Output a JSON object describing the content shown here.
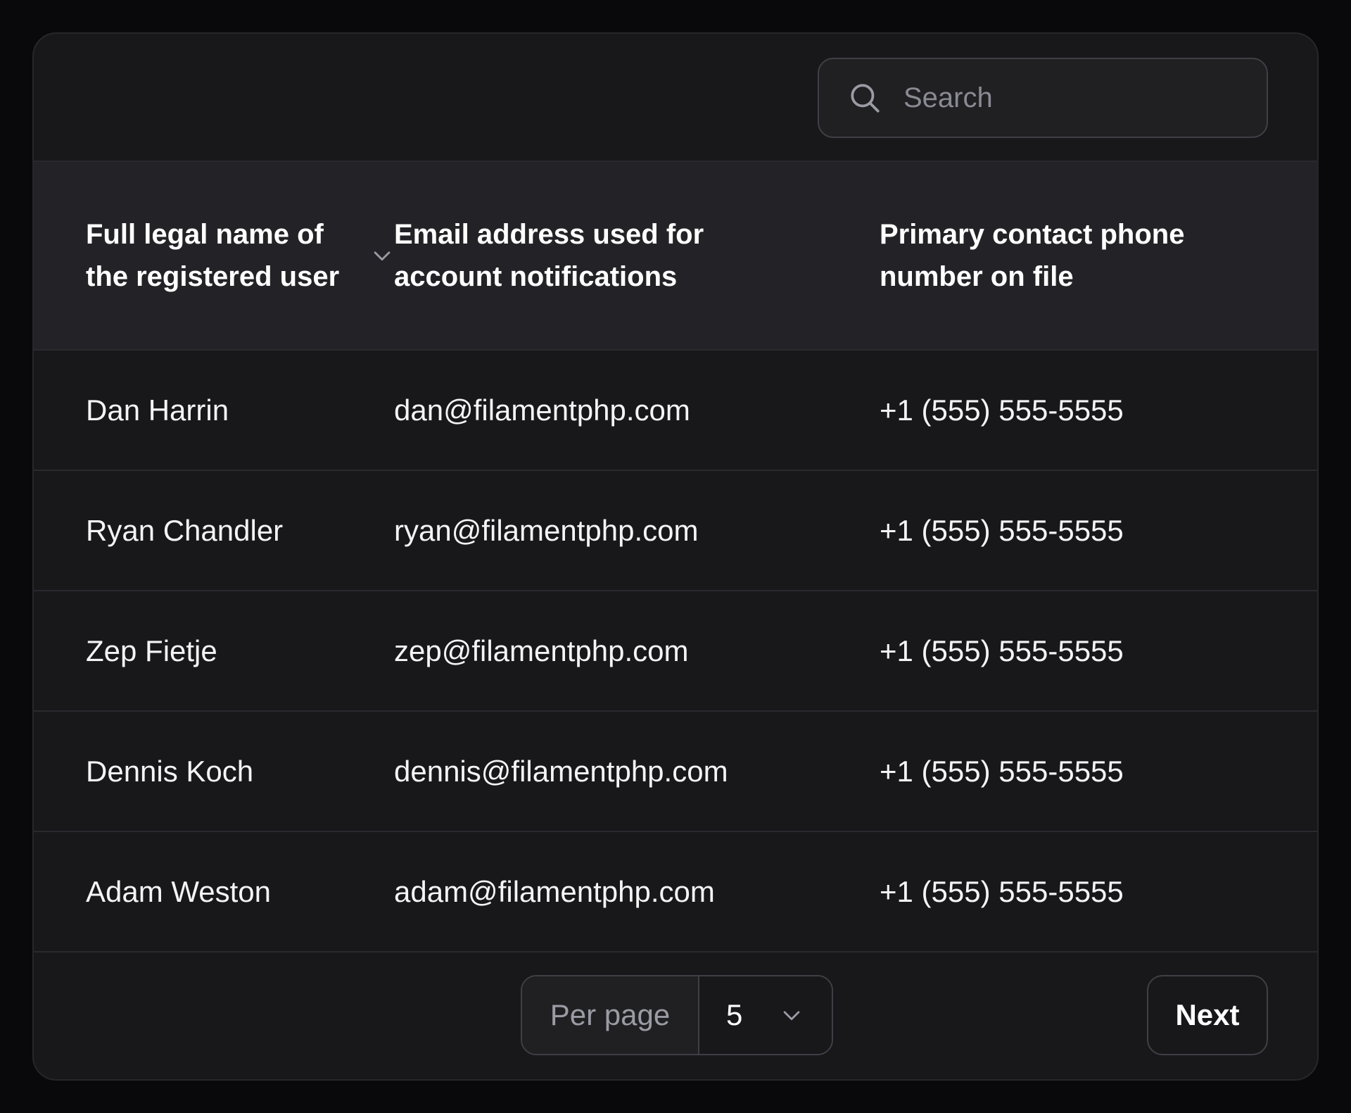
{
  "search": {
    "placeholder": "Search",
    "icon": "search-icon"
  },
  "table": {
    "columns": [
      {
        "label": "Full legal name of the registered user",
        "sortable": true,
        "icon": "chevron-down-icon"
      },
      {
        "label": "Email address used for account notifications"
      },
      {
        "label": "Primary contact phone number on file"
      }
    ],
    "rows": [
      {
        "name": "Dan Harrin",
        "email": "dan@filamentphp.com",
        "phone": "+1 (555) 555-5555"
      },
      {
        "name": "Ryan Chandler",
        "email": "ryan@filamentphp.com",
        "phone": "+1 (555) 555-5555"
      },
      {
        "name": "Zep Fietje",
        "email": "zep@filamentphp.com",
        "phone": "+1 (555) 555-5555"
      },
      {
        "name": "Dennis Koch",
        "email": "dennis@filamentphp.com",
        "phone": "+1 (555) 555-5555"
      },
      {
        "name": "Adam Weston",
        "email": "adam@filamentphp.com",
        "phone": "+1 (555) 555-5555"
      }
    ]
  },
  "pagination": {
    "per_page_label": "Per page",
    "per_page_value": "5",
    "next_label": "Next"
  },
  "colors": {
    "background": "#09090b",
    "card": "#18181b",
    "header": "#232327",
    "border": "#3f3f46"
  }
}
